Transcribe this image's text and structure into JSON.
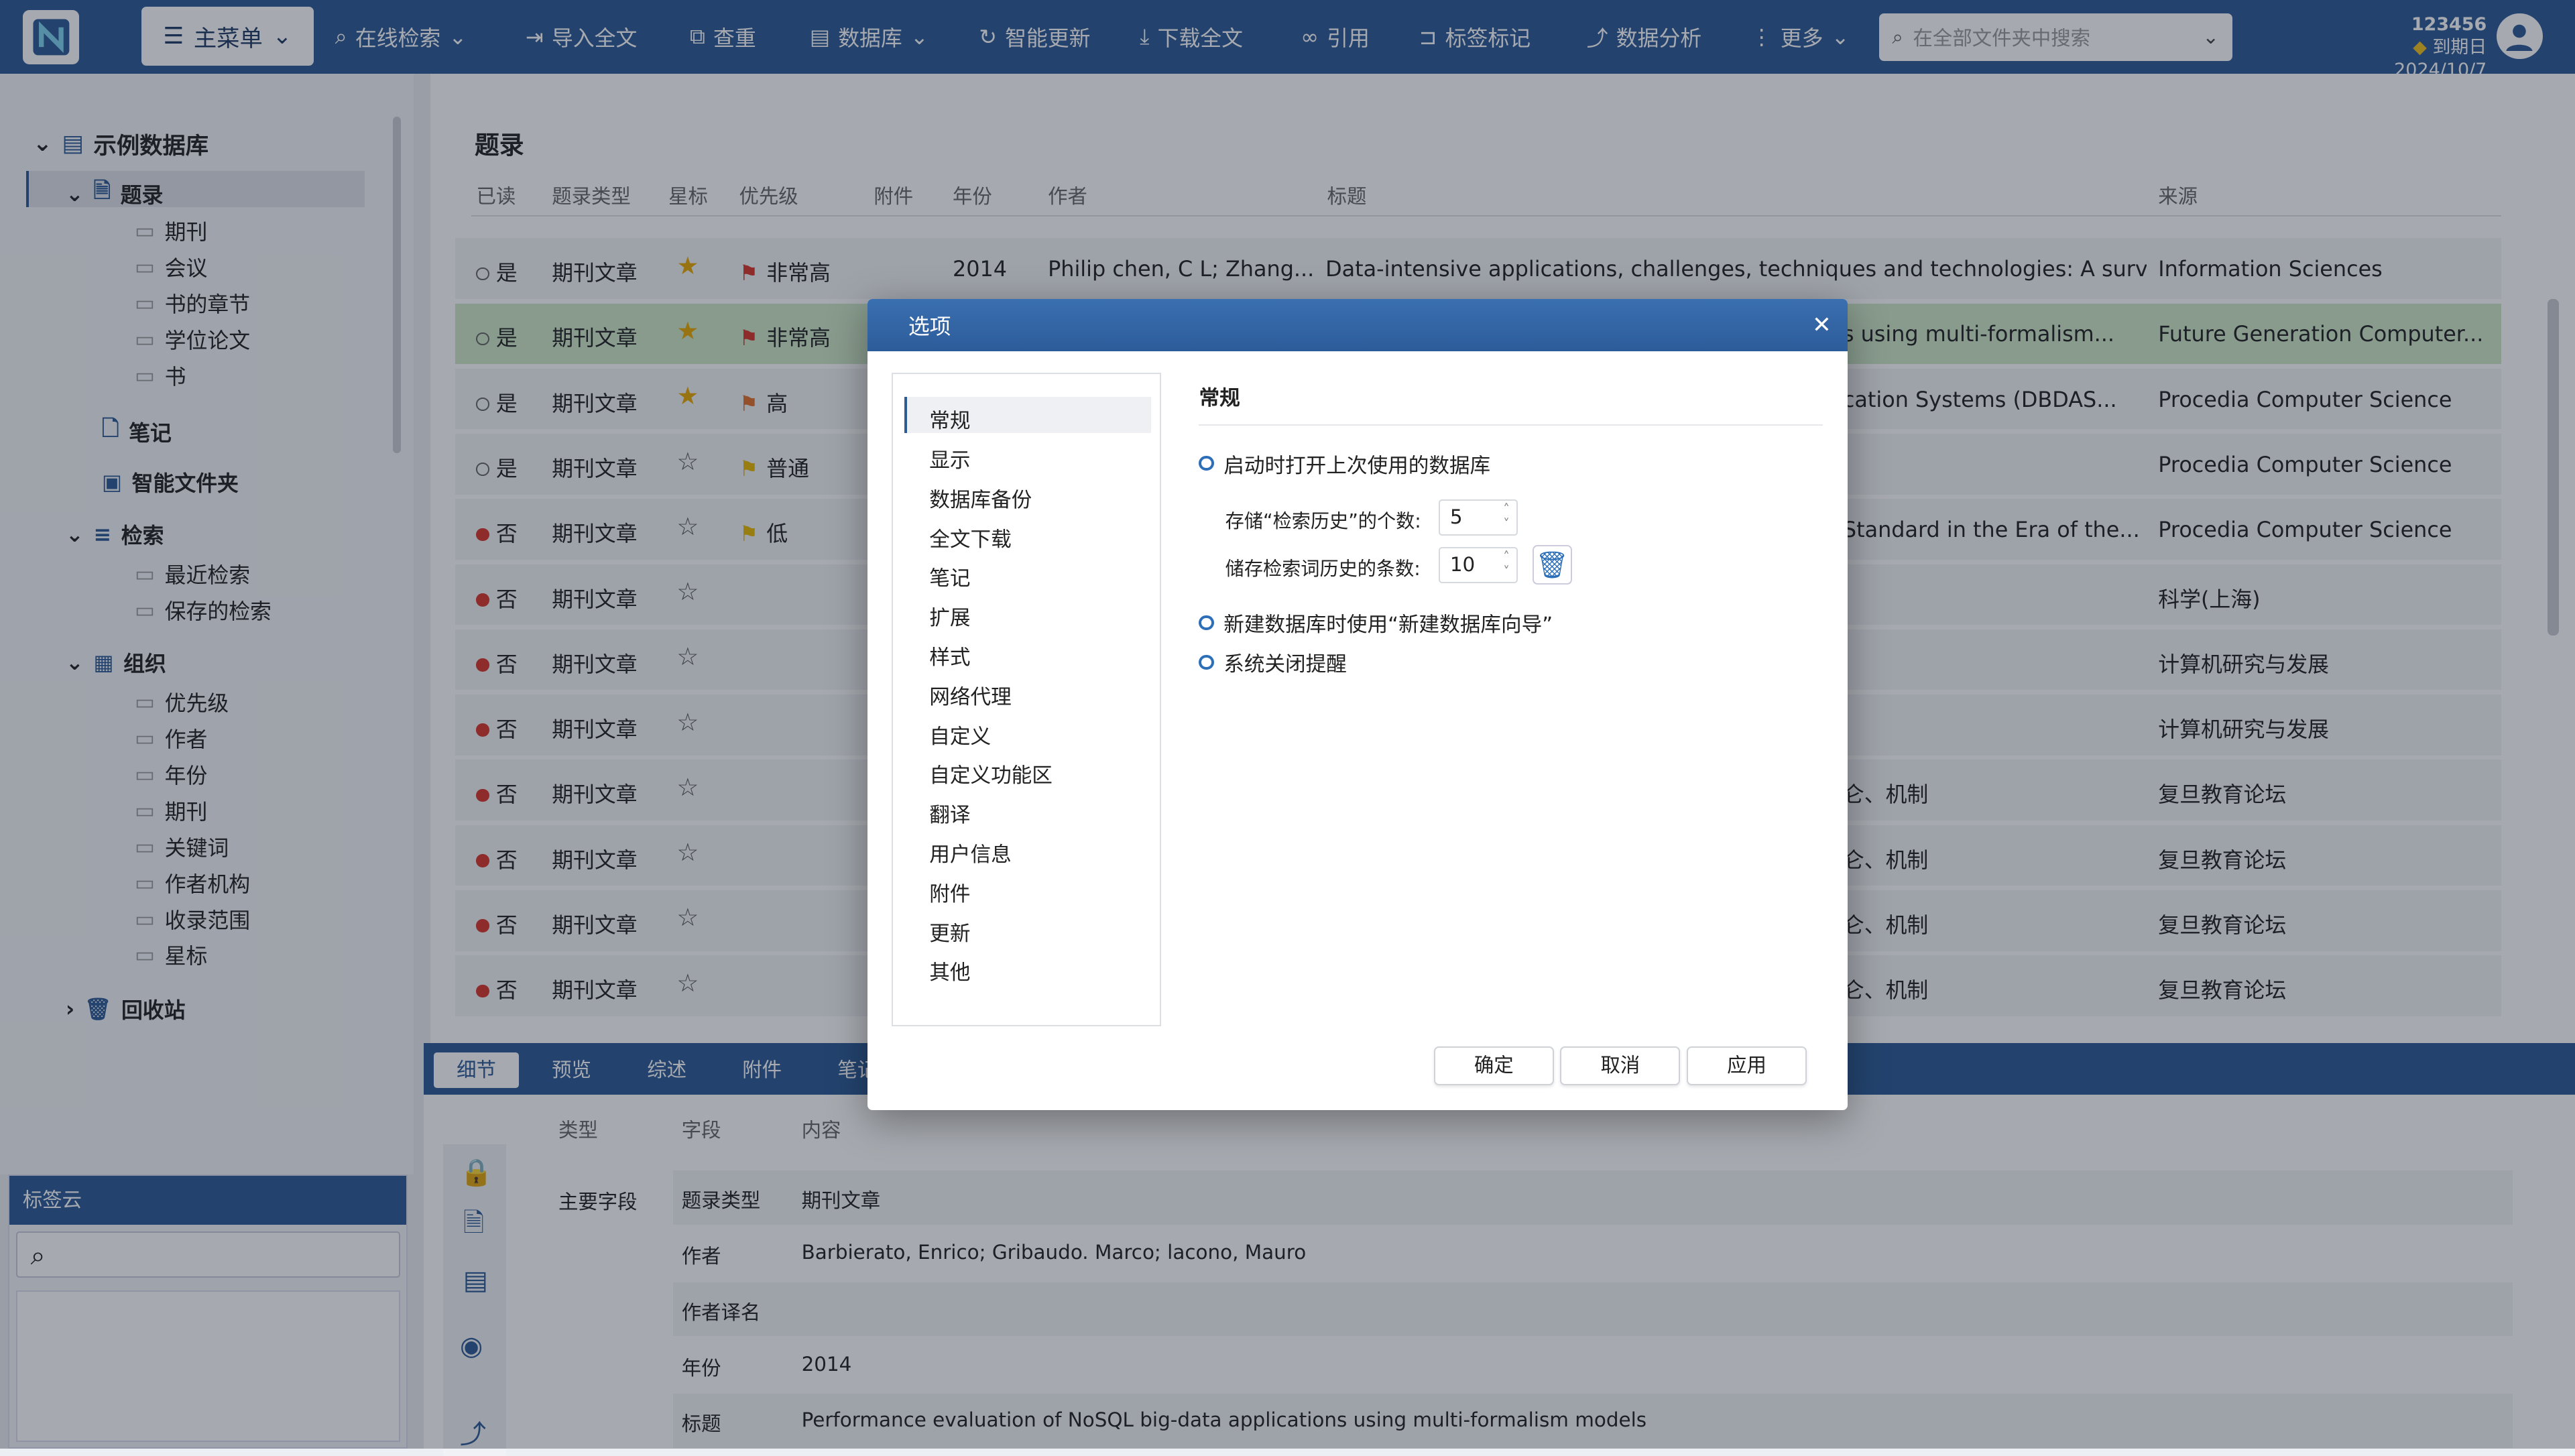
{
  "topbar": {
    "main_menu": "主菜单",
    "items": [
      "在线检索",
      "导入全文",
      "查重",
      "数据库",
      "智能更新",
      "下载全文",
      "引用",
      "标签标记",
      "数据分析",
      "更多"
    ],
    "search_placeholder": "在全部文件夹中搜索",
    "user_name": "123456",
    "expiry": "到期日 2024/10/7"
  },
  "sidebar": {
    "db_name": "示例数据库",
    "records": "题录",
    "record_types": [
      "期刊",
      "会议",
      "书的章节",
      "学位论文",
      "书"
    ],
    "notes": "笔记",
    "smart_folder": "智能文件夹",
    "search": "检索",
    "search_items": [
      "最近检索",
      "保存的检索"
    ],
    "org": "组织",
    "org_items": [
      "优先级",
      "作者",
      "年份",
      "期刊",
      "关键词",
      "作者机构",
      "收录范围",
      "星标"
    ],
    "trash": "回收站",
    "tagcloud_title": "标签云"
  },
  "main": {
    "title": "题录",
    "columns": [
      "已读",
      "题录类型",
      "星标",
      "优先级",
      "附件",
      "年份",
      "作者",
      "标题",
      "来源"
    ],
    "rows": [
      {
        "read": "是",
        "type": "期刊文章",
        "star": true,
        "prio": "非常高",
        "prio_color": "#d9342b",
        "year": "2014",
        "author": "Philip chen, C L; Zhang...",
        "title": "Data-intensive applications, challenges, techniques and technologies: A survey...",
        "source": "Information Sciences"
      },
      {
        "read": "是",
        "type": "期刊文章",
        "star": true,
        "prio": "非常高",
        "prio_color": "#d9342b",
        "year": "",
        "author": "",
        "title": "s using multi-formalism...",
        "source": "Future Generation Computer..."
      },
      {
        "read": "是",
        "type": "期刊文章",
        "star": true,
        "prio": "高",
        "prio_color": "#e0702a",
        "year": "",
        "author": "",
        "title": "cation Systems (DBDAS...",
        "source": "Procedia Computer Science"
      },
      {
        "read": "是",
        "type": "期刊文章",
        "star": false,
        "prio": "普通",
        "prio_color": "#e8b800",
        "year": "",
        "author": "",
        "title": "",
        "source": "Procedia Computer Science"
      },
      {
        "read": "否",
        "type": "期刊文章",
        "star": false,
        "prio": "低",
        "prio_color": "#e8b800",
        "year": "",
        "author": "",
        "title": "Standard in the Era of the...",
        "source": "Procedia Computer Science"
      },
      {
        "read": "否",
        "type": "期刊文章",
        "star": false,
        "prio": "",
        "prio_color": "",
        "year": "",
        "author": "",
        "title": "",
        "source": "科学(上海)"
      },
      {
        "read": "否",
        "type": "期刊文章",
        "star": false,
        "prio": "",
        "prio_color": "",
        "year": "",
        "author": "",
        "title": "",
        "source": "计算机研究与发展"
      },
      {
        "read": "否",
        "type": "期刊文章",
        "star": false,
        "prio": "",
        "prio_color": "",
        "year": "",
        "author": "",
        "title": "",
        "source": "计算机研究与发展"
      },
      {
        "read": "否",
        "type": "期刊文章",
        "star": false,
        "prio": "",
        "prio_color": "",
        "year": "",
        "author": "",
        "title": "仑、机制",
        "source": "复旦教育论坛"
      },
      {
        "read": "否",
        "type": "期刊文章",
        "star": false,
        "prio": "",
        "prio_color": "",
        "year": "",
        "author": "",
        "title": "仑、机制",
        "source": "复旦教育论坛"
      },
      {
        "read": "否",
        "type": "期刊文章",
        "star": false,
        "prio": "",
        "prio_color": "",
        "year": "",
        "author": "",
        "title": "仑、机制",
        "source": "复旦教育论坛"
      },
      {
        "read": "否",
        "type": "期刊文章",
        "star": false,
        "prio": "",
        "prio_color": "",
        "year": "",
        "author": "",
        "title": "仑、机制",
        "source": "复旦教育论坛"
      }
    ]
  },
  "bottom": {
    "tabs": [
      "细节",
      "预览",
      "综述",
      "附件",
      "笔记"
    ],
    "headers": [
      "类型",
      "字段",
      "内容"
    ],
    "group": "主要字段",
    "fields": [
      {
        "field": "题录类型",
        "value": "期刊文章"
      },
      {
        "field": "作者",
        "value": "Barbierato, Enrico; Gribaudo. Marco; lacono, Mauro"
      },
      {
        "field": "作者译名",
        "value": ""
      },
      {
        "field": "年份",
        "value": "2014"
      },
      {
        "field": "标题",
        "value": "Performance evaluation of NoSQL big-data applications using multi-formalism models"
      }
    ]
  },
  "dialog": {
    "title": "选项",
    "nav": [
      "常规",
      "显示",
      "数据库备份",
      "全文下载",
      "笔记",
      "扩展",
      "样式",
      "网络代理",
      "自定义",
      "自定义功能区",
      "翻译",
      "用户信息",
      "附件",
      "更新",
      "其他"
    ],
    "section": "常规",
    "opt_open_last": "启动时打开上次使用的数据库",
    "history_count_label": "存储“检索历史”的个数:",
    "history_count": "5",
    "term_count_label": "储存检索词历史的条数:",
    "term_count": "10",
    "opt_wizard": "新建数据库时使用“新建数据库向导”",
    "opt_close_remind": "系统关闭提醒",
    "ok": "确定",
    "cancel": "取消",
    "apply": "应用"
  },
  "colors": {
    "accent": "#2c5b96",
    "selected_row": "#cfe8c8",
    "unread_dot": "#d9342b",
    "star": "#e8a800"
  }
}
